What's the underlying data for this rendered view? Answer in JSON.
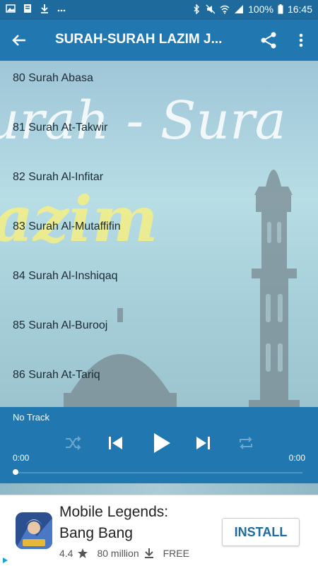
{
  "status_bar": {
    "battery": "100%",
    "time": "16:45",
    "icons": [
      "image-icon",
      "file-icon",
      "download-icon",
      "more-dots-icon",
      "bluetooth-icon",
      "mute-icon",
      "wifi-icon",
      "signal-icon",
      "battery-icon"
    ]
  },
  "app_bar": {
    "title": "SURAH-SURAH LAZIM J...",
    "icons": [
      "back-arrow-icon",
      "share-icon",
      "more-vert-icon"
    ]
  },
  "background": {
    "art_text_1": "urah - Sura",
    "art_text_2": "azim"
  },
  "surah_list": [
    {
      "label": "80 Surah Abasa"
    },
    {
      "label": "81 Surah At-Takwir"
    },
    {
      "label": "82 Surah Al-Infitar"
    },
    {
      "label": "83 Surah Al-Mutaffifin"
    },
    {
      "label": "84 Surah Al-Inshiqaq"
    },
    {
      "label": "85 Surah Al-Burooj"
    },
    {
      "label": "86 Surah At-Tariq"
    }
  ],
  "player": {
    "track": "No Track",
    "current_time": "0:00",
    "total_time": "0:00",
    "progress": 0,
    "icons": [
      "shuffle-icon",
      "previous-icon",
      "play-icon",
      "next-icon",
      "repeat-icon"
    ]
  },
  "ad": {
    "title_line1": "Mobile Legends:",
    "title_line2": "Bang Bang",
    "rating": "4.4",
    "downloads": "80 million",
    "price": "FREE",
    "install_label": "INSTALL"
  },
  "colors": {
    "primary": "#2178b0",
    "status_bar": "#1e6a9c",
    "title_yellow": "#f2ef8a"
  }
}
